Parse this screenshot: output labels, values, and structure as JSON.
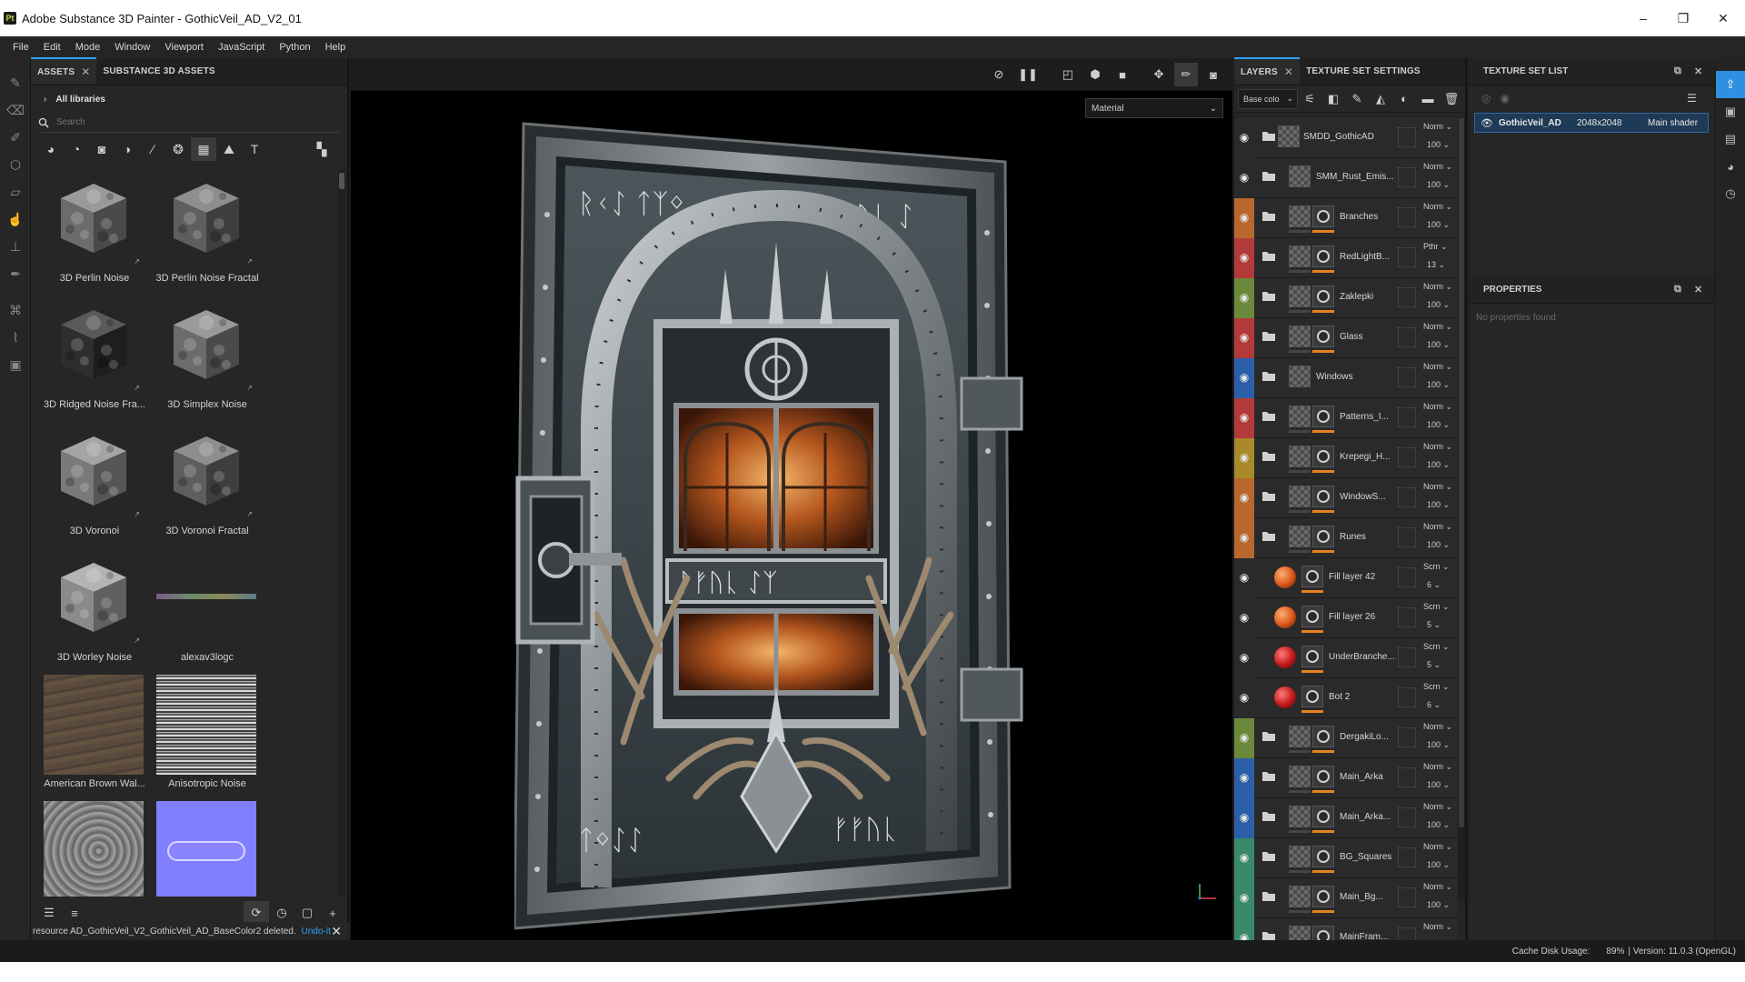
{
  "window": {
    "title": "Adobe Substance 3D Painter - GothicVeil_AD_V2_01",
    "logo_text": "Pt",
    "minimize": "–",
    "maximize": "❐",
    "close": "✕"
  },
  "menu": [
    "File",
    "Edit",
    "Mode",
    "Window",
    "Viewport",
    "JavaScript",
    "Python",
    "Help"
  ],
  "assets_panel": {
    "tabs": [
      {
        "label": "ASSETS",
        "active": true
      },
      {
        "label": "SUBSTANCE 3D ASSETS",
        "active": false
      }
    ],
    "library": "All libraries",
    "search_placeholder": "Search",
    "items": [
      {
        "label": "3D Perlin Noise",
        "type": "cube",
        "tone": "soft"
      },
      {
        "label": "3D Perlin Noise Fractal",
        "type": "cube",
        "tone": "fractal"
      },
      {
        "label": "3D Ridged Noise Fra...",
        "type": "cube",
        "tone": "ridged"
      },
      {
        "label": "3D Simplex Noise",
        "type": "cube",
        "tone": "soft"
      },
      {
        "label": "3D Voronoi",
        "type": "cube",
        "tone": "voronoi"
      },
      {
        "label": "3D Voronoi Fractal",
        "type": "cube",
        "tone": "fractal"
      },
      {
        "label": "3D Worley Noise",
        "type": "cube",
        "tone": "worley"
      },
      {
        "label": "alexav3logc",
        "type": "strip"
      },
      {
        "label": "American Brown Wal...",
        "type": "wood"
      },
      {
        "label": "Anisotropic Noise",
        "type": "aniso"
      },
      {
        "label": "",
        "type": "swirl"
      },
      {
        "label": "",
        "type": "normal"
      }
    ]
  },
  "status_message": {
    "text": "resource AD_GothicVeil_V2_GothicVeil_AD_BaseColor2 deleted.",
    "undo": "Undo-it"
  },
  "viewport": {
    "material_dropdown": "Material"
  },
  "layers_panel": {
    "tabs": [
      {
        "label": "LAYERS",
        "active": true
      },
      {
        "label": "TEXTURE SET SETTINGS",
        "active": false
      }
    ],
    "channel": "Base colo",
    "layers": [
      {
        "name": "SMDD_GothicAD",
        "blend": "Norm",
        "opacity": "100",
        "color": "#2a2a2a",
        "kind": "group-root"
      },
      {
        "name": "SMM_Rust_Emis...",
        "blend": "Norm",
        "opacity": "100",
        "color": "#2a2a2a",
        "kind": "group"
      },
      {
        "name": "Branches",
        "blend": "Norm",
        "opacity": "100",
        "color": "#b8682c",
        "kind": "group-mask"
      },
      {
        "name": "RedLightB...",
        "blend": "Pthr",
        "opacity": "13",
        "color": "#b33a3a",
        "kind": "group-mask"
      },
      {
        "name": "Zaklepki",
        "blend": "Norm",
        "opacity": "100",
        "color": "#6a8a3a",
        "kind": "group-mask"
      },
      {
        "name": "Glass",
        "blend": "Norm",
        "opacity": "100",
        "color": "#b33a3a",
        "kind": "group-mask"
      },
      {
        "name": "Windows",
        "blend": "Norm",
        "opacity": "100",
        "color": "#2d5fa8",
        "kind": "group"
      },
      {
        "name": "Patterns_I...",
        "blend": "Norm",
        "opacity": "100",
        "color": "#b33a3a",
        "kind": "group-mask"
      },
      {
        "name": "Krepegi_H...",
        "blend": "Norm",
        "opacity": "100",
        "color": "#a88a2a",
        "kind": "group-mask"
      },
      {
        "name": "WindowS...",
        "blend": "Norm",
        "opacity": "100",
        "color": "#b8682c",
        "kind": "group-mask"
      },
      {
        "name": "Runes",
        "blend": "Norm",
        "opacity": "100",
        "color": "#b8682c",
        "kind": "group-mask"
      },
      {
        "name": "Fill layer 42",
        "blend": "Scrn",
        "opacity": "6",
        "color": "#2a2a2a",
        "kind": "fill-orange"
      },
      {
        "name": "Fill layer 26",
        "blend": "Scrn",
        "opacity": "5",
        "color": "#2a2a2a",
        "kind": "fill-orange"
      },
      {
        "name": "UnderBranche...",
        "blend": "Scrn",
        "opacity": "5",
        "color": "#2a2a2a",
        "kind": "fill-red"
      },
      {
        "name": "Bot 2",
        "blend": "Scrn",
        "opacity": "6",
        "color": "#2a2a2a",
        "kind": "fill-red"
      },
      {
        "name": "DergakiLo...",
        "blend": "Norm",
        "opacity": "100",
        "color": "#6a8a3a",
        "kind": "group-mask"
      },
      {
        "name": "Main_Arka",
        "blend": "Norm",
        "opacity": "100",
        "color": "#2d5fa8",
        "kind": "group-mask"
      },
      {
        "name": "Main_Arka...",
        "blend": "Norm",
        "opacity": "100",
        "color": "#2d5fa8",
        "kind": "group-mask"
      },
      {
        "name": "BG_Squares",
        "blend": "Norm",
        "opacity": "100",
        "color": "#3a8a6a",
        "kind": "group-mask"
      },
      {
        "name": "Main_Bg...",
        "blend": "Norm",
        "opacity": "100",
        "color": "#3a8a6a",
        "kind": "group-mask"
      },
      {
        "name": "MainFram...",
        "blend": "Norm",
        "opacity": "",
        "color": "#3a8a6a",
        "kind": "group-mask"
      }
    ]
  },
  "texture_set_list": {
    "title": "TEXTURE SET LIST",
    "row": {
      "name": "GothicVeil_AD",
      "resolution": "2048x2048",
      "shader": "Main shader"
    }
  },
  "properties": {
    "title": "PROPERTIES",
    "empty": "No properties found"
  },
  "status_bar": {
    "cache_label": "Cache Disk Usage:",
    "cache_value": "89%",
    "version": "| Version: 11.0.3 (OpenGL)"
  },
  "viewport_door_runes": {
    "top": "ᚱᚲᛇ ᛏᛉᛜ",
    "top_right": "ᚠᚠᚢᚳ ᛇ",
    "middle": "ᚹᚠᚢᚳ ᛇᛉ",
    "bottom_left": "ᛏᛜᛇᛇ",
    "bottom_right": "ᚠᚠᚢᚳ"
  }
}
